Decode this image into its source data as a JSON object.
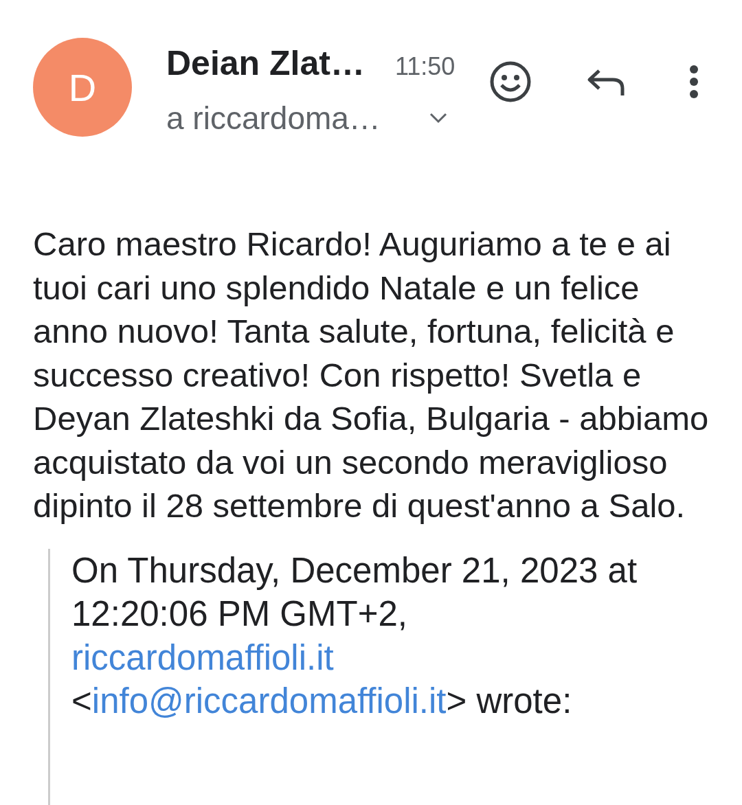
{
  "header": {
    "avatar_letter": "D",
    "sender": "Deian Zlat…",
    "time": "11:50",
    "recipient": "a riccardoma…"
  },
  "body": "Caro maestro Ricardo! Auguriamo a te e ai tuoi cari uno splendido Natale e un felice anno nuovo! Tanta salute, fortuna, felicità e successo creativo! Con rispetto! Svetla e Deyan Zlateshki da Sofia, Bulgaria - abbiamo acquistato da voi un secondo meraviglioso dipinto il 28 settembre di quest'anno a Salo.",
  "quote": {
    "intro": "On Thursday, December 21, 2023 at 12:20:06 PM GMT+2,",
    "sender_link": "riccardomaffioli.it",
    "open": "<",
    "email_link": "info@riccardomaffioli.it",
    "close": "> wrote:"
  }
}
